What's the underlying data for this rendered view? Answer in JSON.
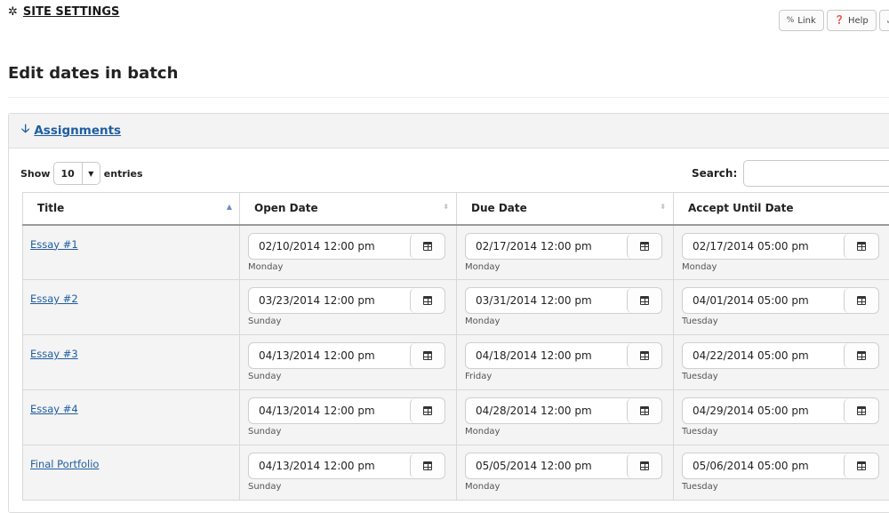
{
  "header": {
    "site_settings": "SITE SETTINGS",
    "buttons": [
      {
        "label": "Link",
        "icon": "link-icon"
      },
      {
        "label": "Help",
        "icon": "help-icon"
      }
    ]
  },
  "page": {
    "title": "Edit dates in batch"
  },
  "panel": {
    "title": "Assignments"
  },
  "controls": {
    "show_label": "Show",
    "entries_value": "10",
    "entries_label": "entries",
    "search_label": "Search:",
    "search_value": ""
  },
  "table": {
    "columns": [
      "Title",
      "Open Date",
      "Due Date",
      "Accept Until Date"
    ],
    "rows": [
      {
        "title": "Essay #1",
        "open": "02/10/2014 12:00 pm",
        "open_day": "Monday",
        "due": "02/17/2014 12:00 pm",
        "due_day": "Monday",
        "accept": "02/17/2014 05:00 pm",
        "accept_day": "Monday"
      },
      {
        "title": "Essay #2",
        "open": "03/23/2014 12:00 pm",
        "open_day": "Sunday",
        "due": "03/31/2014 12:00 pm",
        "due_day": "Monday",
        "accept": "04/01/2014 05:00 pm",
        "accept_day": "Tuesday"
      },
      {
        "title": "Essay #3",
        "open": "04/13/2014 12:00 pm",
        "open_day": "Sunday",
        "due": "04/18/2014 12:00 pm",
        "due_day": "Friday",
        "accept": "04/22/2014 05:00 pm",
        "accept_day": "Tuesday"
      },
      {
        "title": "Essay #4",
        "open": "04/13/2014 12:00 pm",
        "open_day": "Sunday",
        "due": "04/28/2014 12:00 pm",
        "due_day": "Monday",
        "accept": "04/29/2014 05:00 pm",
        "accept_day": "Tuesday"
      },
      {
        "title": "Final Portfolio",
        "open": "04/13/2014 12:00 pm",
        "open_day": "Sunday",
        "due": "05/05/2014 12:00 pm",
        "due_day": "Monday",
        "accept": "05/06/2014 05:00 pm",
        "accept_day": "Tuesday"
      }
    ]
  },
  "colors": {
    "link": "#1f5da0",
    "row_bg": "#f4f4f4",
    "heading_bg": "#f3f3f3"
  }
}
